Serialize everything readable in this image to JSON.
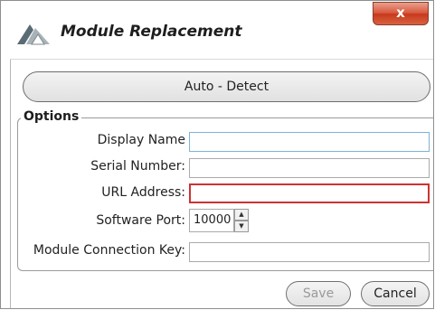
{
  "window": {
    "title": "Module Replacement",
    "close_label": "x"
  },
  "auto_detect": {
    "label": "Auto - Detect"
  },
  "options": {
    "label": "Options",
    "display_name": {
      "label": "Display Name",
      "value": ""
    },
    "serial_number": {
      "label": "Serial Number:",
      "value": ""
    },
    "url_address": {
      "label": "URL Address:",
      "value": ""
    },
    "software_port": {
      "label": "Software Port:",
      "value": "10000"
    },
    "connection_key": {
      "label": "Module Connection Key:",
      "value": ""
    }
  },
  "buttons": {
    "save": "Save",
    "cancel": "Cancel"
  },
  "colors": {
    "close": "#d8573c",
    "error_border": "#cc3333",
    "focus_border": "#7fb3d6"
  }
}
